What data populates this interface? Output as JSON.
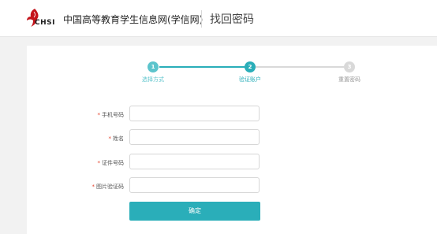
{
  "header": {
    "logo_text": "CHSI",
    "site_name": "中国高等教育学生信息网(学信网)",
    "page_title": "找回密码"
  },
  "steps": [
    {
      "number": "1",
      "label": "选择方式",
      "state": "done"
    },
    {
      "number": "2",
      "label": "验证账户",
      "state": "active"
    },
    {
      "number": "3",
      "label": "重置密码",
      "state": "pending"
    }
  ],
  "form": {
    "required_mark": "*",
    "phone_label": "手机号码",
    "phone_value": "",
    "name_label": "姓名",
    "name_value": "",
    "id_label": "证件号码",
    "id_value": "",
    "captcha_label": "图片验证码",
    "captcha_value": "",
    "confirm_label": "确定"
  },
  "colors": {
    "accent": "#2aaeb9",
    "required": "#e5412b",
    "inactive": "#d9d9d9"
  }
}
